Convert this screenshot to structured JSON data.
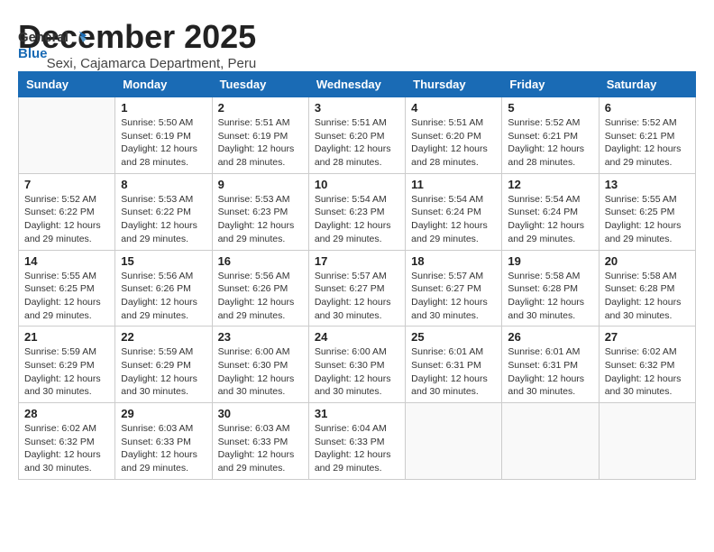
{
  "logo": {
    "line1": "General",
    "line2": "Blue"
  },
  "title": "December 2025",
  "subtitle": "Sexi, Cajamarca Department, Peru",
  "days_of_week": [
    "Sunday",
    "Monday",
    "Tuesday",
    "Wednesday",
    "Thursday",
    "Friday",
    "Saturday"
  ],
  "weeks": [
    [
      {
        "day": "",
        "info": ""
      },
      {
        "day": "1",
        "info": "Sunrise: 5:50 AM\nSunset: 6:19 PM\nDaylight: 12 hours\nand 28 minutes."
      },
      {
        "day": "2",
        "info": "Sunrise: 5:51 AM\nSunset: 6:19 PM\nDaylight: 12 hours\nand 28 minutes."
      },
      {
        "day": "3",
        "info": "Sunrise: 5:51 AM\nSunset: 6:20 PM\nDaylight: 12 hours\nand 28 minutes."
      },
      {
        "day": "4",
        "info": "Sunrise: 5:51 AM\nSunset: 6:20 PM\nDaylight: 12 hours\nand 28 minutes."
      },
      {
        "day": "5",
        "info": "Sunrise: 5:52 AM\nSunset: 6:21 PM\nDaylight: 12 hours\nand 28 minutes."
      },
      {
        "day": "6",
        "info": "Sunrise: 5:52 AM\nSunset: 6:21 PM\nDaylight: 12 hours\nand 29 minutes."
      }
    ],
    [
      {
        "day": "7",
        "info": "Sunrise: 5:52 AM\nSunset: 6:22 PM\nDaylight: 12 hours\nand 29 minutes."
      },
      {
        "day": "8",
        "info": "Sunrise: 5:53 AM\nSunset: 6:22 PM\nDaylight: 12 hours\nand 29 minutes."
      },
      {
        "day": "9",
        "info": "Sunrise: 5:53 AM\nSunset: 6:23 PM\nDaylight: 12 hours\nand 29 minutes."
      },
      {
        "day": "10",
        "info": "Sunrise: 5:54 AM\nSunset: 6:23 PM\nDaylight: 12 hours\nand 29 minutes."
      },
      {
        "day": "11",
        "info": "Sunrise: 5:54 AM\nSunset: 6:24 PM\nDaylight: 12 hours\nand 29 minutes."
      },
      {
        "day": "12",
        "info": "Sunrise: 5:54 AM\nSunset: 6:24 PM\nDaylight: 12 hours\nand 29 minutes."
      },
      {
        "day": "13",
        "info": "Sunrise: 5:55 AM\nSunset: 6:25 PM\nDaylight: 12 hours\nand 29 minutes."
      }
    ],
    [
      {
        "day": "14",
        "info": "Sunrise: 5:55 AM\nSunset: 6:25 PM\nDaylight: 12 hours\nand 29 minutes."
      },
      {
        "day": "15",
        "info": "Sunrise: 5:56 AM\nSunset: 6:26 PM\nDaylight: 12 hours\nand 29 minutes."
      },
      {
        "day": "16",
        "info": "Sunrise: 5:56 AM\nSunset: 6:26 PM\nDaylight: 12 hours\nand 29 minutes."
      },
      {
        "day": "17",
        "info": "Sunrise: 5:57 AM\nSunset: 6:27 PM\nDaylight: 12 hours\nand 30 minutes."
      },
      {
        "day": "18",
        "info": "Sunrise: 5:57 AM\nSunset: 6:27 PM\nDaylight: 12 hours\nand 30 minutes."
      },
      {
        "day": "19",
        "info": "Sunrise: 5:58 AM\nSunset: 6:28 PM\nDaylight: 12 hours\nand 30 minutes."
      },
      {
        "day": "20",
        "info": "Sunrise: 5:58 AM\nSunset: 6:28 PM\nDaylight: 12 hours\nand 30 minutes."
      }
    ],
    [
      {
        "day": "21",
        "info": "Sunrise: 5:59 AM\nSunset: 6:29 PM\nDaylight: 12 hours\nand 30 minutes."
      },
      {
        "day": "22",
        "info": "Sunrise: 5:59 AM\nSunset: 6:29 PM\nDaylight: 12 hours\nand 30 minutes."
      },
      {
        "day": "23",
        "info": "Sunrise: 6:00 AM\nSunset: 6:30 PM\nDaylight: 12 hours\nand 30 minutes."
      },
      {
        "day": "24",
        "info": "Sunrise: 6:00 AM\nSunset: 6:30 PM\nDaylight: 12 hours\nand 30 minutes."
      },
      {
        "day": "25",
        "info": "Sunrise: 6:01 AM\nSunset: 6:31 PM\nDaylight: 12 hours\nand 30 minutes."
      },
      {
        "day": "26",
        "info": "Sunrise: 6:01 AM\nSunset: 6:31 PM\nDaylight: 12 hours\nand 30 minutes."
      },
      {
        "day": "27",
        "info": "Sunrise: 6:02 AM\nSunset: 6:32 PM\nDaylight: 12 hours\nand 30 minutes."
      }
    ],
    [
      {
        "day": "28",
        "info": "Sunrise: 6:02 AM\nSunset: 6:32 PM\nDaylight: 12 hours\nand 30 minutes."
      },
      {
        "day": "29",
        "info": "Sunrise: 6:03 AM\nSunset: 6:33 PM\nDaylight: 12 hours\nand 29 minutes."
      },
      {
        "day": "30",
        "info": "Sunrise: 6:03 AM\nSunset: 6:33 PM\nDaylight: 12 hours\nand 29 minutes."
      },
      {
        "day": "31",
        "info": "Sunrise: 6:04 AM\nSunset: 6:33 PM\nDaylight: 12 hours\nand 29 minutes."
      },
      {
        "day": "",
        "info": ""
      },
      {
        "day": "",
        "info": ""
      },
      {
        "day": "",
        "info": ""
      }
    ]
  ]
}
